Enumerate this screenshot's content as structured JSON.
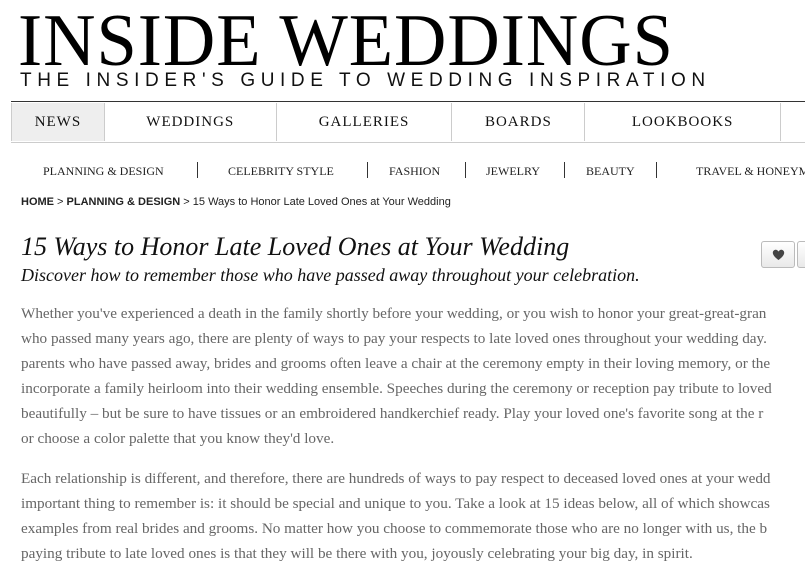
{
  "logo": {
    "title": "INSIDE WEDDINGS",
    "tagline": "THE INSIDER'S GUIDE TO WEDDING INSPIRATION"
  },
  "nav": {
    "items": [
      {
        "label": "NEWS",
        "active": true
      },
      {
        "label": "WEDDINGS"
      },
      {
        "label": "GALLERIES"
      },
      {
        "label": "BOARDS"
      },
      {
        "label": "LOOKBOOKS"
      }
    ]
  },
  "subnav": {
    "items": [
      "PLANNING & DESIGN",
      "CELEBRITY STYLE",
      "FASHION",
      "JEWELRY",
      "BEAUTY",
      "TRAVEL & HONEYM"
    ]
  },
  "breadcrumb": {
    "home": "HOME",
    "sep1": " > ",
    "section": "PLANNING & DESIGN",
    "sep2": " > ",
    "current": "15 Ways to Honor Late Loved Ones at Your Wedding"
  },
  "article": {
    "title": "15 Ways to Honor Late Loved Ones at Your Wedding",
    "subtitle": "Discover how to remember those who have passed away throughout your celebration.",
    "like_icon": "heart-icon",
    "paragraph1": [
      "Whether you've experienced a death in the family shortly before your wedding, or you wish to honor your great-great-gran",
      "who passed many years ago, there are plenty of ways to pay your respects to late loved ones throughout your wedding day.",
      "parents who have passed away, brides and grooms often leave a chair at the ceremony empty in their loving memory, or the",
      "incorporate a family heirloom into their wedding ensemble. Speeches during the ceremony or reception pay tribute to loved",
      "beautifully – but be sure to have tissues or an embroidered handkerchief ready. Play your loved one's favorite song at the r",
      "or choose a color palette that you know they'd love."
    ],
    "paragraph2": [
      "Each relationship is different, and therefore, there are hundreds of ways to pay respect to deceased loved ones at your wedd",
      "important thing to remember is: it should be special and unique to you. Take a look at 15 ideas below, all of which showcas",
      "examples from real brides and grooms. No matter how you choose to commemorate those who are no longer with us, the b",
      "paying tribute to late loved ones is that they will be there with you, joyously celebrating your big day, in spirit."
    ]
  }
}
